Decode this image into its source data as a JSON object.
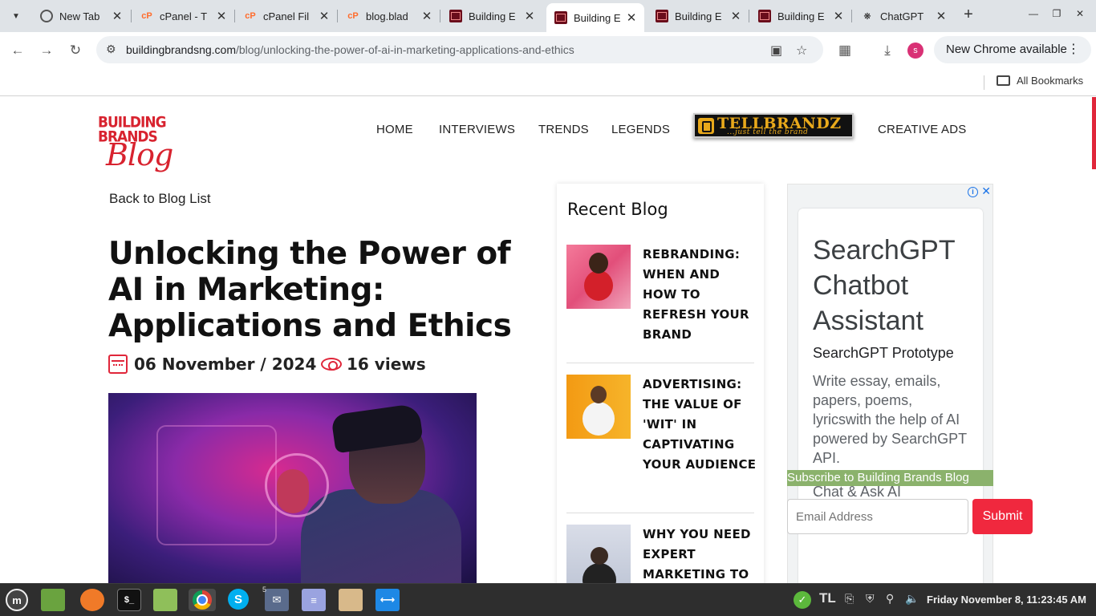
{
  "browser": {
    "tabs": [
      {
        "label": "New Tab",
        "favicon": "chrome-icon"
      },
      {
        "label": "cPanel - T",
        "favicon": "cpanel-icon"
      },
      {
        "label": "cPanel Fil",
        "favicon": "cpanel-icon"
      },
      {
        "label": "blog.blad",
        "favicon": "cpanel-icon"
      },
      {
        "label": "Building E",
        "favicon": "building-brands-icon"
      },
      {
        "label": "Building E",
        "favicon": "building-brands-icon",
        "active": true
      },
      {
        "label": "Building E",
        "favicon": "building-brands-icon"
      },
      {
        "label": "Building E",
        "favicon": "building-brands-icon"
      },
      {
        "label": "ChatGPT",
        "favicon": "chatgpt-icon"
      }
    ],
    "url_domain": "buildingbrandsng.com",
    "url_path": "/blog/unlocking-the-power-of-ai-in-marketing-applications-and-ethics",
    "profile_initial": "s",
    "update_label": "New Chrome available",
    "bookmarks_label": "All Bookmarks"
  },
  "site": {
    "logo": {
      "line1": "BUILDING",
      "line2": "BRANDS",
      "line3": "Blog"
    },
    "nav": [
      "HOME",
      "INTERVIEWS",
      "TRENDS",
      "LEGENDS",
      "CREATIVE ADS"
    ],
    "tellbrandz": {
      "main": "TELLBRANDZ",
      "sub": "...just tell the brand"
    }
  },
  "article": {
    "back_link": "Back to Blog List",
    "title": "Unlocking the Power of AI in Marketing: Applications and Ethics",
    "date": "06 November / 2024",
    "views": "16 views"
  },
  "recent_blog": {
    "heading": "Recent Blog",
    "items": [
      {
        "title": "REBRANDING: WHEN AND HOW TO REFRESH YOUR BRAND"
      },
      {
        "title": "ADVERTISING: THE VALUE OF 'WIT' IN CAPTIVATING YOUR AUDIENCE"
      },
      {
        "title": "WHY YOU NEED EXPERT MARKETING TO"
      }
    ]
  },
  "ad": {
    "headline": "SearchGPT Chatbot Assistant",
    "subhead": "SearchGPT Prototype",
    "description": "Write essay, emails, papers, poems, lyricswith the help of AI powered by SearchGPT API.",
    "description2": "Chat & Ask AI"
  },
  "subscribe": {
    "banner": "Subscribe to Building Brands Blog",
    "email_placeholder": "Email Address",
    "submit_label": "Submit"
  },
  "taskbar": {
    "mail_badge": "5",
    "clock": "Friday November  8, 11:23:45 AM"
  },
  "colors": {
    "accent": "#e0263a",
    "submit": "#f0283e",
    "subscribe_bar": "#8bb26c",
    "ad_link": "#1a73e8"
  }
}
